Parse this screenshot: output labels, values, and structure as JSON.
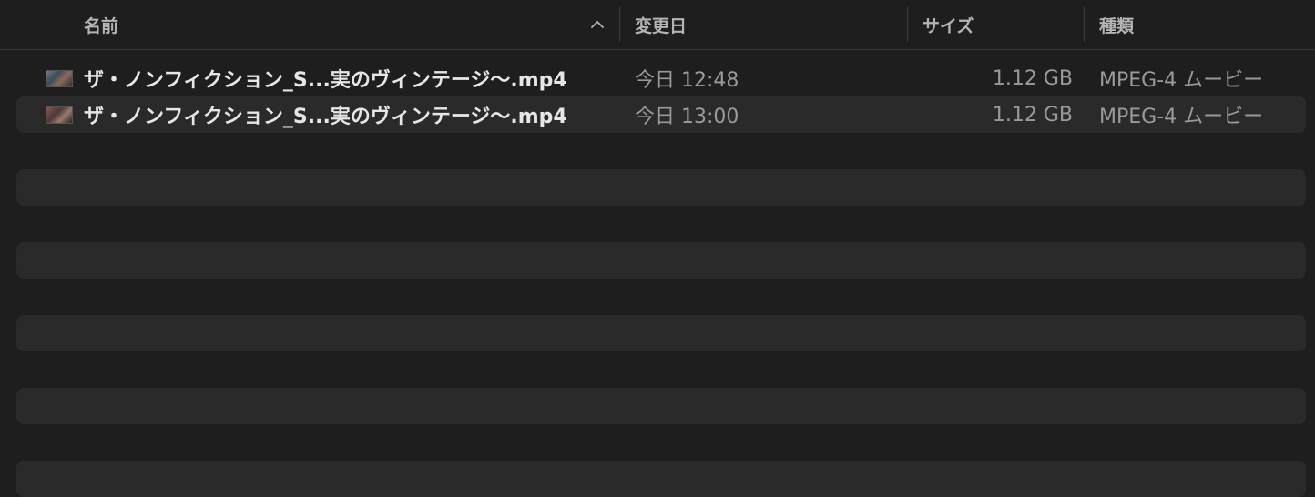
{
  "columns": {
    "name": "名前",
    "modified": "変更日",
    "size": "サイズ",
    "kind": "種類"
  },
  "sort": {
    "icon": "chevron-up-icon"
  },
  "files": [
    {
      "name": "ザ・ノンフィクション_S...実のヴィンテージ〜.mp4",
      "modified": "今日 12:48",
      "size": "1.12 GB",
      "kind": "MPEG-4 ムービー",
      "icon": "video-thumbnail-icon"
    },
    {
      "name": "ザ・ノンフィクション_S...実のヴィンテージ〜.mp4",
      "modified": "今日 13:00",
      "size": "1.12 GB",
      "kind": "MPEG-4 ムービー",
      "icon": "video-thumbnail-icon"
    }
  ],
  "colors": {
    "background": "#1e1e1e",
    "alt_row": "#2a2a2a",
    "header_text": "#b4b4b4",
    "primary_text": "#e6e6e6",
    "secondary_text": "#9a9a9a"
  }
}
